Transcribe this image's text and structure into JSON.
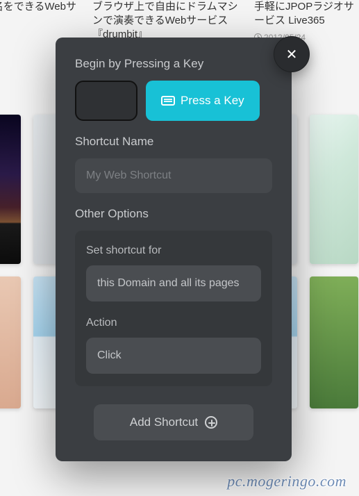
{
  "background": {
    "cards": [
      {
        "title": "ビスのユーザ名をできるWebサービス"
      },
      {
        "title": "ブラウザ上で自由にドラムマシンで演奏できるWebサービス『drumbit』"
      },
      {
        "title": "手軽にJPOPラジオサービス Live365",
        "date": "2012/05/24"
      }
    ],
    "watermark": "pc.mogeringo.com"
  },
  "modal": {
    "close_icon": "✕",
    "begin_title": "Begin by Pressing a Key",
    "press_button": "Press a Key",
    "shortcut_name_title": "Shortcut Name",
    "shortcut_name_placeholder": "My Web Shortcut",
    "shortcut_name_value": "",
    "other_options_title": "Other Options",
    "scope_label": "Set shortcut for",
    "scope_value": "this Domain and all its pages",
    "action_label": "Action",
    "action_value": "Click",
    "add_button": "Add Shortcut"
  }
}
